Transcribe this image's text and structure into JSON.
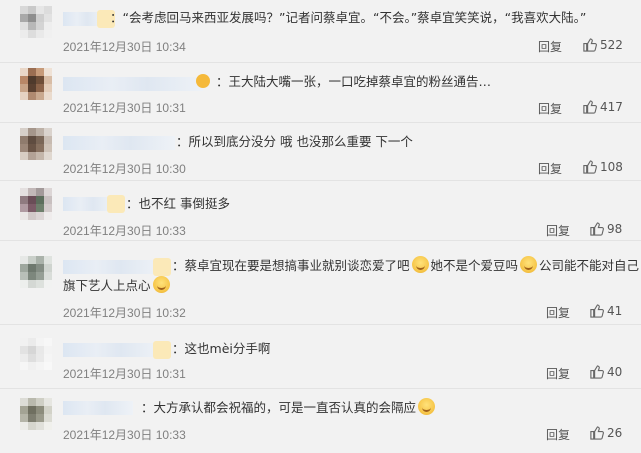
{
  "reply_label": "回复",
  "comments": [
    {
      "text": "“会考虑回马来西亚发展吗？”记者问蔡卓宜。“不会。”蔡卓宜笑笑说，“我喜欢大陆。”",
      "time": "2021年12月30日 10:34",
      "likes": "522"
    },
    {
      "text": "王大陆大嘴一张，一口吃掉蔡卓宜的粉丝通告…",
      "time": "2021年12月30日 10:31",
      "likes": "417"
    },
    {
      "text": "所以到底分没分 哦 也没那么重要 下一个",
      "time": "2021年12月30日 10:30",
      "likes": "108"
    },
    {
      "text": "也不红 事倒挺多",
      "time": "2021年12月30日 10:33",
      "likes": "98"
    },
    {
      "text_parts": [
        "蔡卓宜现在要是想搞事业就别谈恋爱了吧",
        "她不是个爱豆吗",
        "公司能不能对自己"
      ],
      "text_line2": "旗下艺人上点心",
      "time": "2021年12月30日 10:32",
      "likes": "41"
    },
    {
      "text": "这也mèi分手啊",
      "time": "2021年12月30日 10:31",
      "likes": "40"
    },
    {
      "text": "大方承认都会祝福的，可是一直否认真的会隔应",
      "time": "2021年12月30日 10:33",
      "likes": "26"
    }
  ]
}
